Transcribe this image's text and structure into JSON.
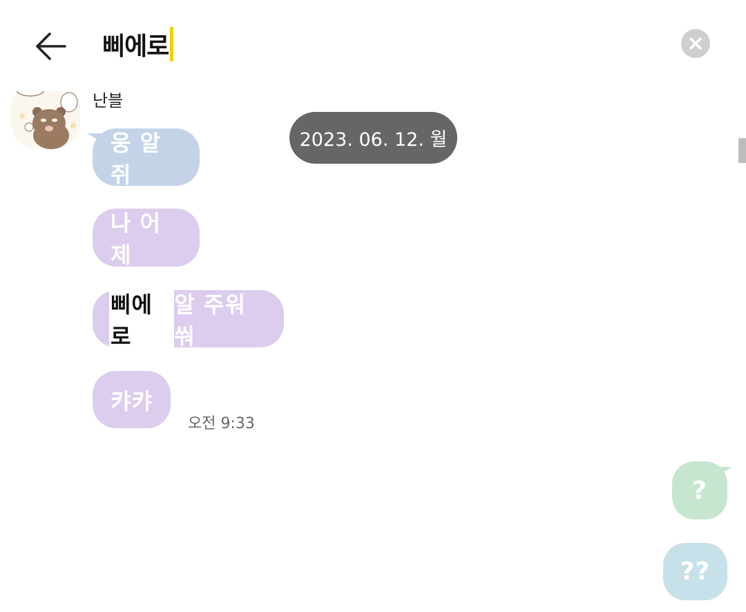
{
  "search": {
    "query": "삐에로"
  },
  "header": {
    "back_icon": "arrow-left-icon",
    "clear_icon": "close-icon"
  },
  "chat": {
    "sender_name": "난블",
    "date_label": "2023. 06. 12. 월",
    "incoming": [
      {
        "text": "웅 알쥐"
      },
      {
        "text": "나 어제"
      },
      {
        "highlight": "삐에로",
        "rest": "알 주워쒀"
      },
      {
        "text": "캬캬"
      }
    ],
    "incoming_time": "오전 9:33",
    "outgoing": [
      {
        "text": "?"
      },
      {
        "text": "??"
      }
    ]
  },
  "colors": {
    "caret": "#f5d000",
    "bubble_blue": "#c4d3e8",
    "bubble_purple": "#dccdee",
    "bubble_green": "#c6e6d0",
    "bubble_teal": "#c6e1e9",
    "date_badge": "#666666"
  }
}
